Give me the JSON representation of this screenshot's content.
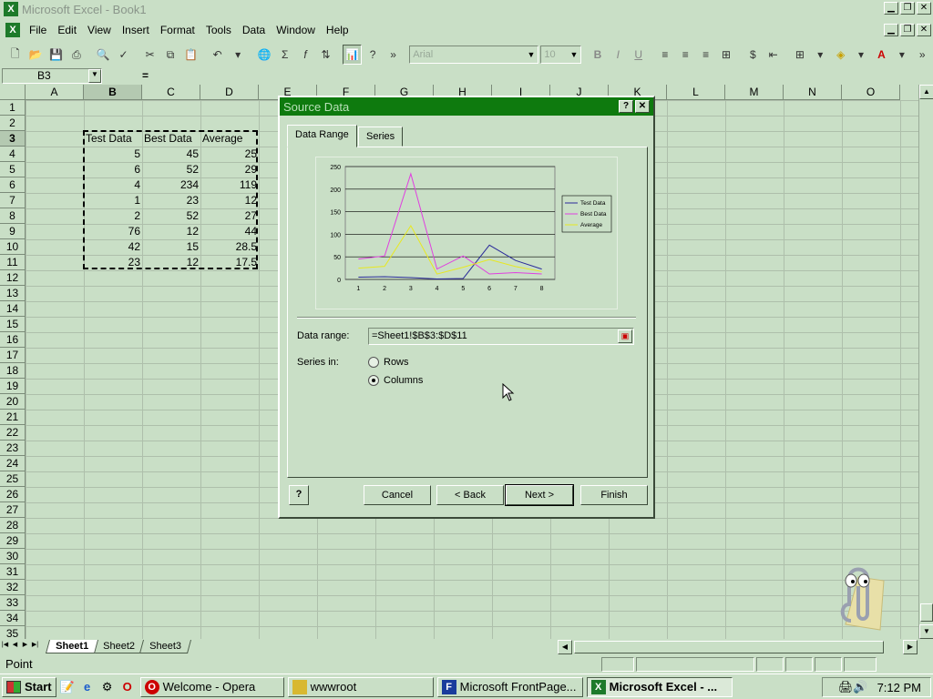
{
  "window": {
    "title": "Microsoft Excel - Book1"
  },
  "menu": [
    "File",
    "Edit",
    "View",
    "Insert",
    "Format",
    "Tools",
    "Data",
    "Window",
    "Help"
  ],
  "toolbar": {
    "font_name": "Arial",
    "font_size": "10"
  },
  "formula": {
    "name_box": "B3",
    "equals": "="
  },
  "columns": [
    "A",
    "B",
    "C",
    "D",
    "E",
    "F",
    "G",
    "H",
    "I",
    "J",
    "K",
    "L",
    "M",
    "N",
    "O"
  ],
  "rows": [
    "1",
    "2",
    "3",
    "4",
    "5",
    "6",
    "7",
    "8",
    "9",
    "10",
    "11",
    "12",
    "13",
    "14",
    "15",
    "16",
    "17",
    "18",
    "19",
    "20",
    "21",
    "22",
    "23",
    "24",
    "25",
    "26",
    "27",
    "28",
    "29",
    "30",
    "31",
    "32",
    "33",
    "34",
    "35"
  ],
  "sheet_data": {
    "headers": [
      "Test Data",
      "Best Data",
      "Average"
    ],
    "values": [
      [
        "5",
        "45",
        "25"
      ],
      [
        "6",
        "52",
        "29"
      ],
      [
        "4",
        "234",
        "119"
      ],
      [
        "1",
        "23",
        "12"
      ],
      [
        "2",
        "52",
        "27"
      ],
      [
        "76",
        "12",
        "44"
      ],
      [
        "42",
        "15",
        "28.5"
      ],
      [
        "23",
        "12",
        "17.5"
      ]
    ]
  },
  "sheet_tabs": [
    "Sheet1",
    "Sheet2",
    "Sheet3"
  ],
  "status": {
    "text": "Point"
  },
  "dialog": {
    "title": "Source Data",
    "tabs": [
      "Data Range",
      "Series"
    ],
    "data_range_label": "Data range:",
    "data_range_value": "=Sheet1!$B$3:$D$11",
    "series_in_label": "Series in:",
    "series_options": [
      {
        "label": "Rows",
        "selected": false
      },
      {
        "label": "Columns",
        "selected": true
      }
    ],
    "buttons": {
      "cancel": "Cancel",
      "back": "< Back",
      "next": "Next >",
      "finish": "Finish"
    }
  },
  "chart_data": {
    "type": "line",
    "x": [
      1,
      2,
      3,
      4,
      5,
      6,
      7,
      8
    ],
    "ylim": [
      0,
      250
    ],
    "yticks": [
      0,
      50,
      100,
      150,
      200,
      250
    ],
    "grid": true,
    "legend": "right",
    "series": [
      {
        "name": "Test Data",
        "values": [
          5,
          6,
          4,
          1,
          2,
          76,
          42,
          23
        ],
        "color": "#2a2a9a"
      },
      {
        "name": "Best Data",
        "values": [
          45,
          52,
          234,
          23,
          52,
          12,
          15,
          12
        ],
        "color": "#e040e0"
      },
      {
        "name": "Average",
        "values": [
          25,
          29,
          119,
          12,
          27,
          44,
          28.5,
          17.5
        ],
        "color": "#e8e820"
      }
    ]
  },
  "taskbar": {
    "start": "Start",
    "tasks": [
      {
        "label": "Welcome - Opera",
        "active": false
      },
      {
        "label": "wwwroot",
        "active": false
      },
      {
        "label": "Microsoft FrontPage...",
        "active": false
      },
      {
        "label": "Microsoft Excel - ...",
        "active": true
      }
    ],
    "clock": "7:12 PM"
  }
}
